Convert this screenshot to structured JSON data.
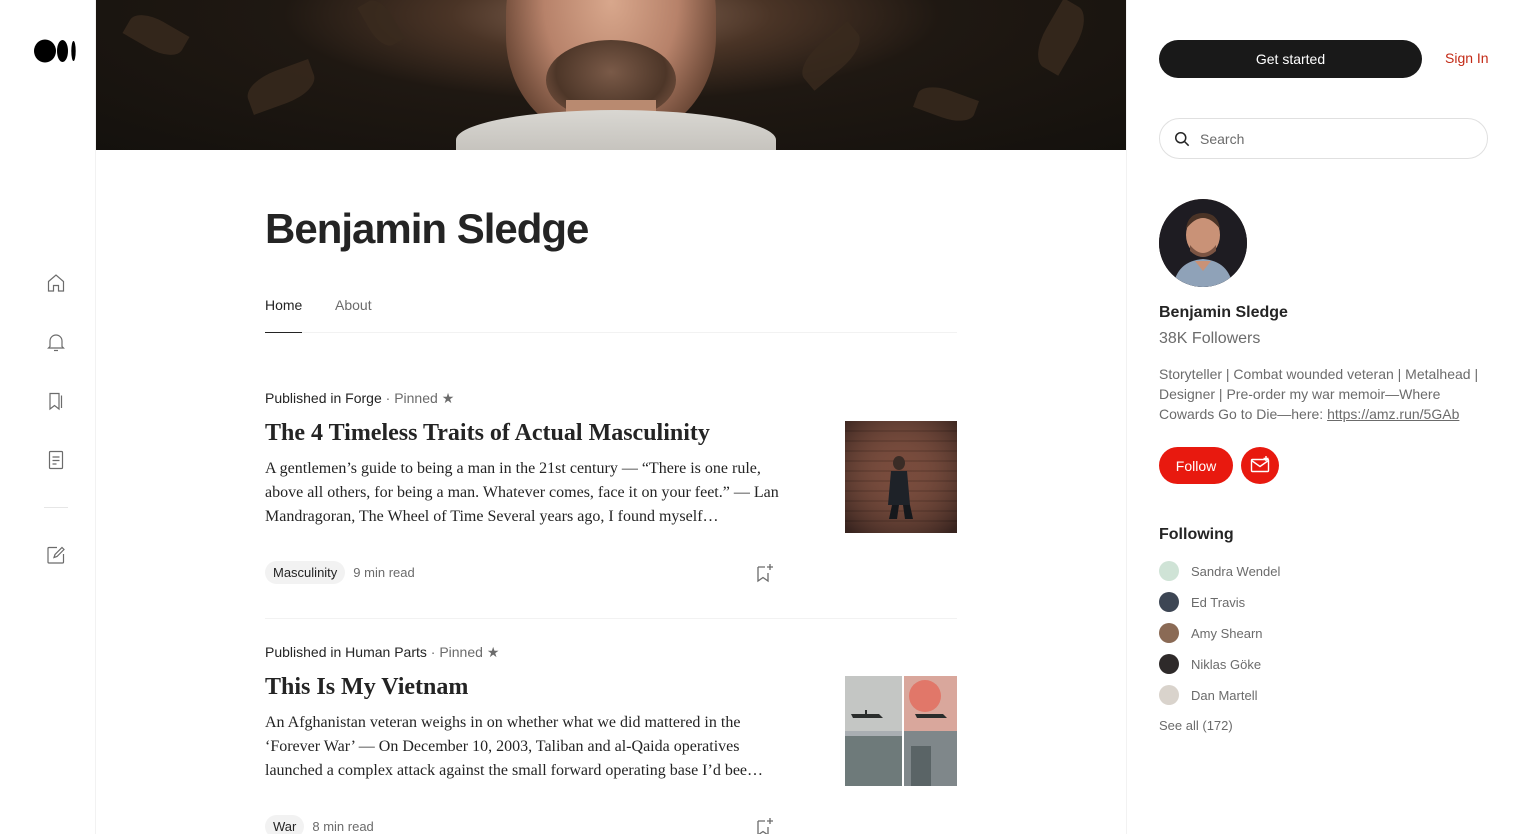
{
  "nav": {
    "icons": [
      "medium-logo",
      "home-icon",
      "notifications-icon",
      "bookmarks-icon",
      "stories-icon",
      "write-icon"
    ]
  },
  "profile": {
    "name": "Benjamin Sledge",
    "tabs": [
      {
        "label": "Home",
        "active": true
      },
      {
        "label": "About",
        "active": false
      }
    ]
  },
  "posts": [
    {
      "published_in_label": "Published in ",
      "publication": "Forge",
      "pinned_label": " · Pinned",
      "star": "★",
      "title": "The 4 Timeless Traits of Actual Masculinity",
      "excerpt": "A gentlemen’s guide to being a man in the 21st century — “There is one rule, above all others, for being a man. Whatever comes, face it on your feet.” — Lan Mandragoran, The Wheel of Time Several years ago, I found myself…",
      "tag": "Masculinity",
      "read_time": "9 min read"
    },
    {
      "published_in_label": "Published in ",
      "publication": "Human Parts",
      "pinned_label": " · Pinned",
      "star": "★",
      "title": "This Is My Vietnam",
      "excerpt": "An Afghanistan veteran weighs in on whether what we did mattered in the ‘Forever War’ — On December 10, 2003, Taliban and al-Qaida operatives launched a complex attack against the small forward operating base I’d bee…",
      "tag": "War",
      "read_time": "8 min read"
    }
  ],
  "sidebar": {
    "get_started": "Get started",
    "sign_in": "Sign In",
    "search_placeholder": "Search",
    "name": "Benjamin Sledge",
    "followers": "38K Followers",
    "bio_text": "Storyteller | Combat wounded veteran | Metalhead | Designer | Pre-order my war memoir—Where Cowards Go to Die—here: ",
    "bio_link": "https://amz.run/5GAb",
    "follow_label": "Follow",
    "following_heading": "Following",
    "following": [
      {
        "name": "Sandra Wendel",
        "color": "#cfe3d6"
      },
      {
        "name": "Ed Travis",
        "color": "#3d4654"
      },
      {
        "name": "Amy Shearn",
        "color": "#8a6a55"
      },
      {
        "name": "Niklas Göke",
        "color": "#2e2a2a"
      },
      {
        "name": "Dan Martell",
        "color": "#d9d3cc"
      }
    ],
    "see_all": "See all (172)"
  },
  "colors": {
    "accent_red": "#e8190f",
    "sign_in_red": "#c32a16",
    "dark_button": "#191919"
  }
}
